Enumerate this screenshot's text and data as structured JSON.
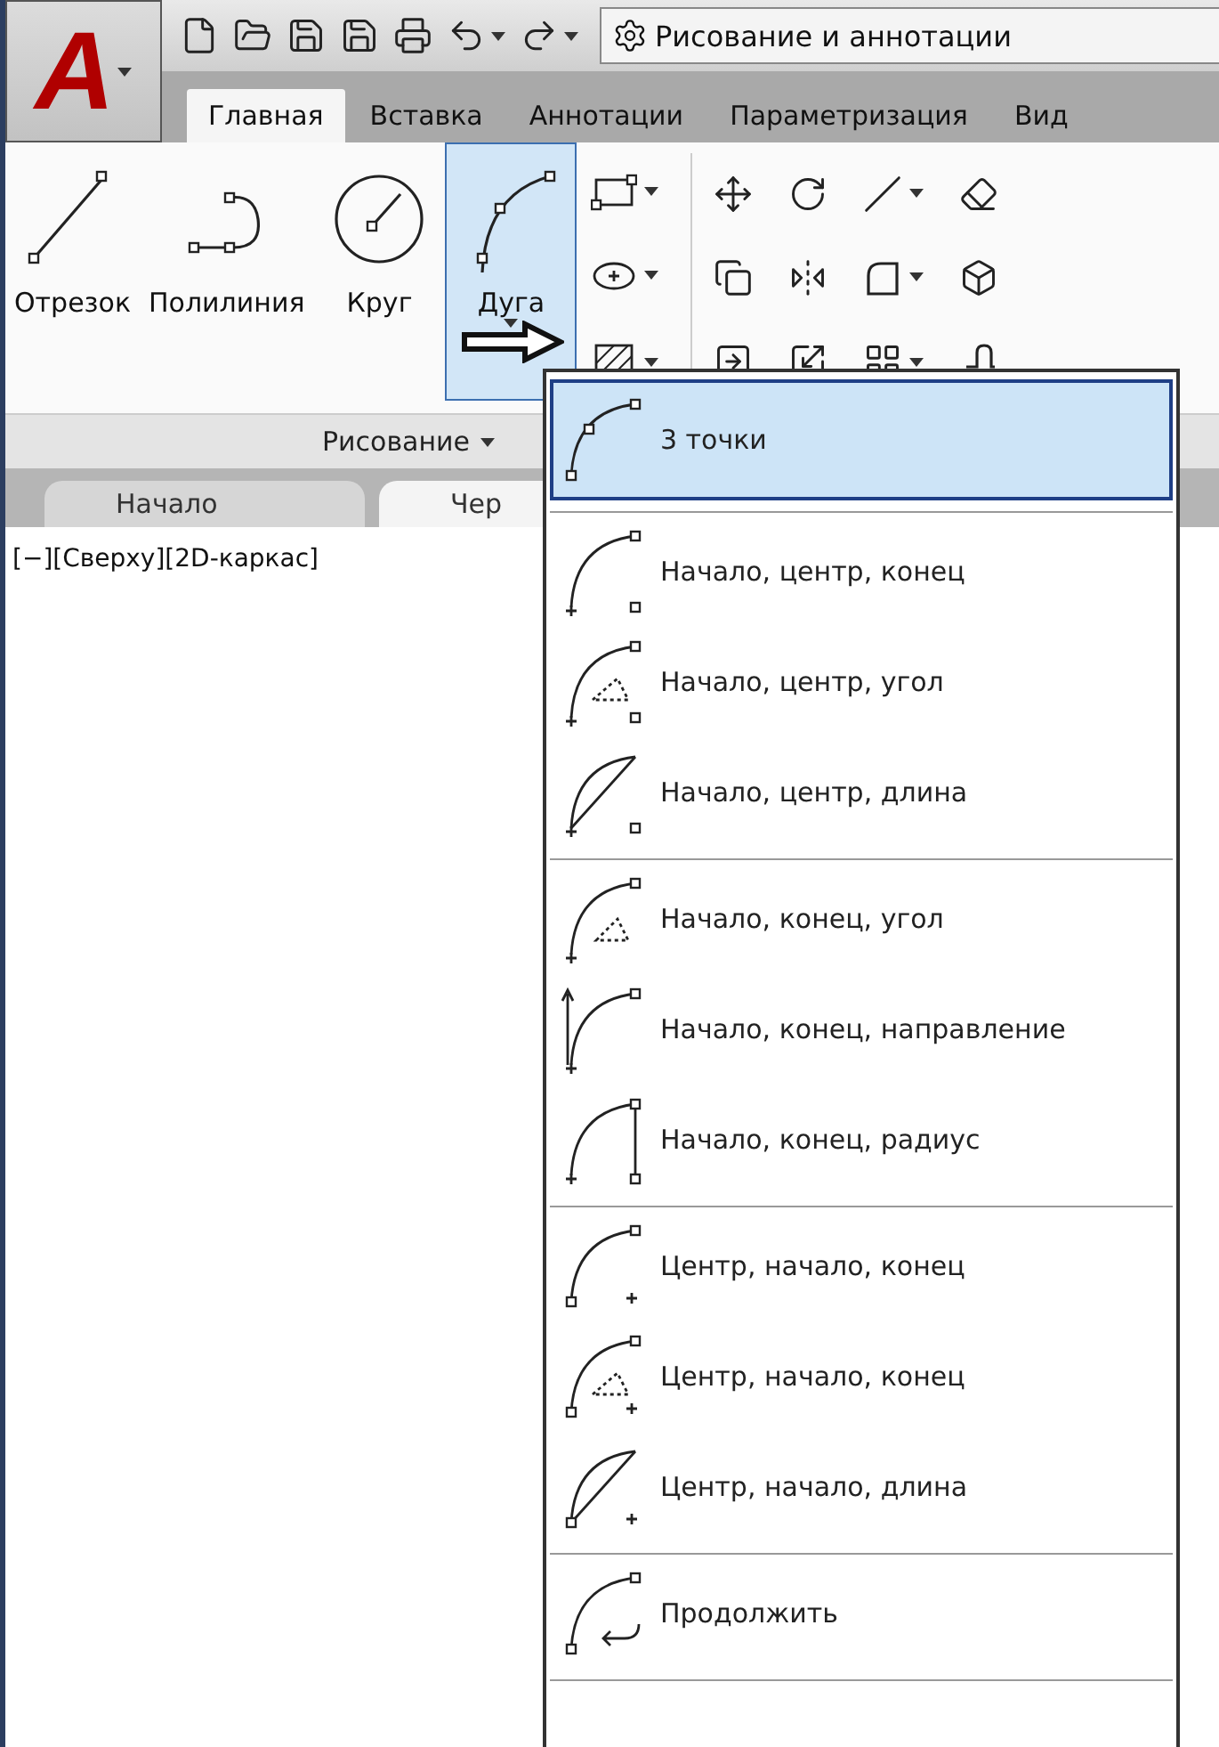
{
  "app_button": {
    "logo_letter": "A"
  },
  "quick_access": {
    "workspace": "Рисование и аннотации"
  },
  "ribbon_tabs": [
    {
      "label": "Главная",
      "selected": true
    },
    {
      "label": "Вставка",
      "selected": false
    },
    {
      "label": "Аннотации",
      "selected": false
    },
    {
      "label": "Параметризация",
      "selected": false
    },
    {
      "label": "Вид",
      "selected": false
    }
  ],
  "draw_panel": {
    "title": "Рисование",
    "tools": [
      {
        "label": "Отрезок",
        "kind": "line",
        "selected": false
      },
      {
        "label": "Полилиния",
        "kind": "polyline",
        "selected": false
      },
      {
        "label": "Круг",
        "kind": "circle",
        "selected": false
      },
      {
        "label": "Дуга",
        "kind": "arc",
        "selected": true
      }
    ]
  },
  "file_tabs": [
    {
      "label": "Начало",
      "selected": false
    },
    {
      "label": "Чер",
      "selected": true
    }
  ],
  "viewport": {
    "controls": "[−][Сверху][2D-каркас]"
  },
  "arc_menu": {
    "groups": [
      {
        "items": [
          {
            "label": "3 точки",
            "kind": "three-point",
            "selected": true
          }
        ]
      },
      {
        "items": [
          {
            "label": "Начало, центр, конец",
            "kind": "sce",
            "selected": false
          },
          {
            "label": "Начало, центр, угол",
            "kind": "sca",
            "selected": false
          },
          {
            "label": "Начало, центр, длина",
            "kind": "scl",
            "selected": false
          }
        ]
      },
      {
        "items": [
          {
            "label": "Начало, конец, угол",
            "kind": "sea",
            "selected": false
          },
          {
            "label": "Начало, конец, направление",
            "kind": "sed",
            "selected": false
          },
          {
            "label": "Начало, конец, радиус",
            "kind": "ser",
            "selected": false
          }
        ]
      },
      {
        "items": [
          {
            "label": "Центр, начало, конец",
            "kind": "cse",
            "selected": false
          },
          {
            "label": "Центр, начало, конец",
            "kind": "csa",
            "selected": false
          },
          {
            "label": "Центр, начало, длина",
            "kind": "csl",
            "selected": false
          }
        ]
      },
      {
        "items": [
          {
            "label": "Продолжить",
            "kind": "continue",
            "selected": false
          }
        ]
      }
    ]
  }
}
